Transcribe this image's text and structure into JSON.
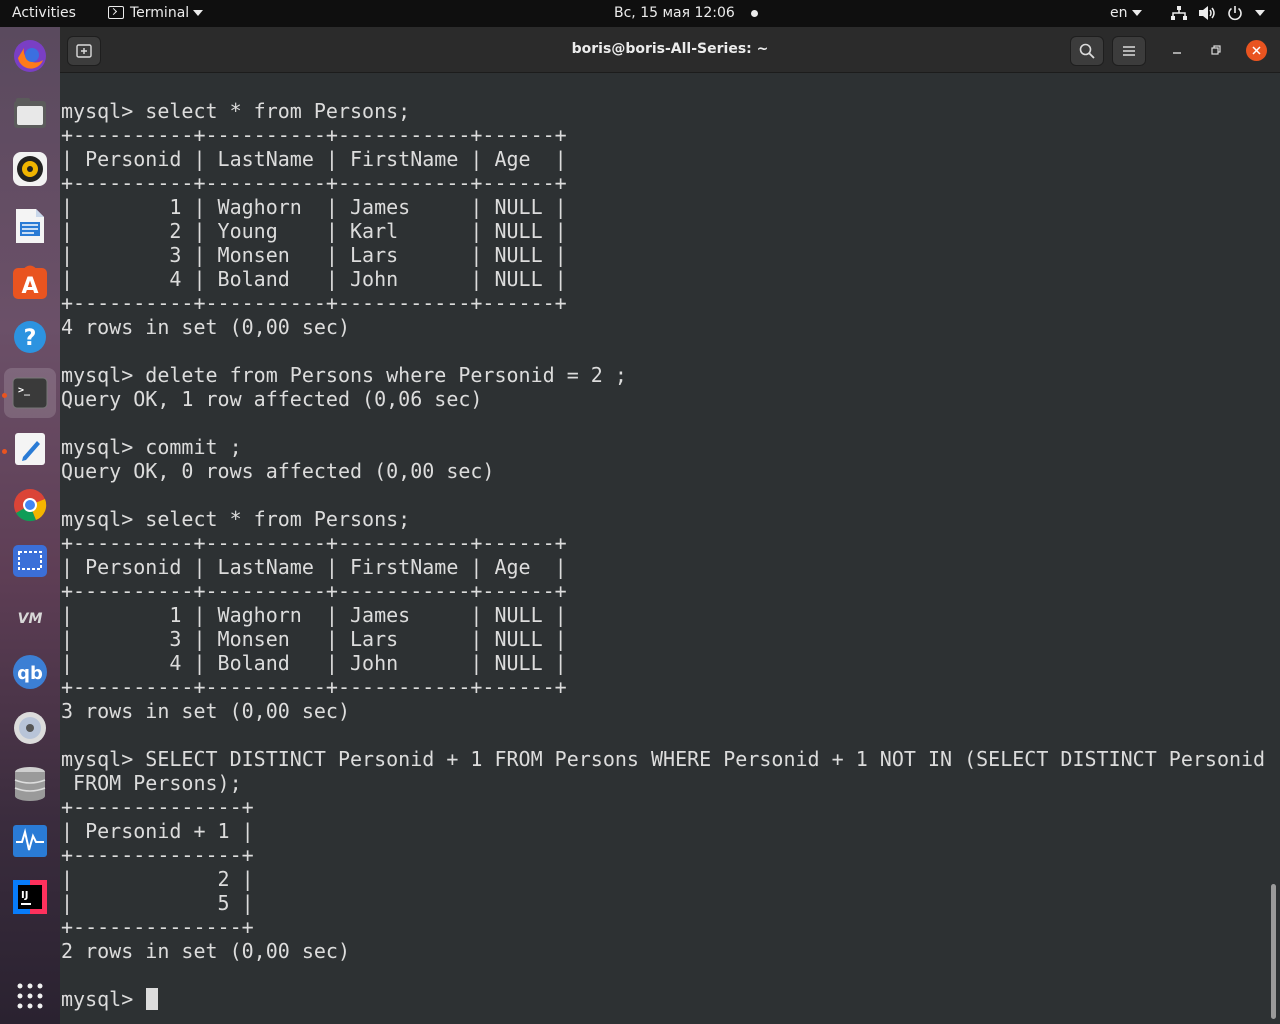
{
  "topbar": {
    "activities": "Activities",
    "app_name": "Terminal",
    "datetime": "Вс, 15 мая  12:06",
    "language": "en"
  },
  "window": {
    "title": "boris@boris-All-Series: ~"
  },
  "dock": {
    "apps": [
      "firefox-icon",
      "files-icon",
      "rhythmbox-icon",
      "libreoffice-writer-icon",
      "ubuntu-software-icon",
      "help-icon",
      "terminal-icon",
      "text-editor-icon",
      "chrome-icon",
      "screenshot-icon",
      "vmware-icon",
      "qbittorrent-icon",
      "disc-icon",
      "database-icon",
      "system-monitor-icon",
      "intellij-icon",
      "show-applications-icon"
    ]
  },
  "terminal": {
    "lines": [
      "mysql> select * from Persons;",
      "+----------+----------+-----------+------+",
      "| Personid | LastName | FirstName | Age  |",
      "+----------+----------+-----------+------+",
      "|        1 | Waghorn  | James     | NULL |",
      "|        2 | Young    | Karl      | NULL |",
      "|        3 | Monsen   | Lars      | NULL |",
      "|        4 | Boland   | John      | NULL |",
      "+----------+----------+-----------+------+",
      "4 rows in set (0,00 sec)",
      "",
      "mysql> delete from Persons where Personid = 2 ;",
      "Query OK, 1 row affected (0,06 sec)",
      "",
      "mysql> commit ;",
      "Query OK, 0 rows affected (0,00 sec)",
      "",
      "mysql> select * from Persons;",
      "+----------+----------+-----------+------+",
      "| Personid | LastName | FirstName | Age  |",
      "+----------+----------+-----------+------+",
      "|        1 | Waghorn  | James     | NULL |",
      "|        3 | Monsen   | Lars      | NULL |",
      "|        4 | Boland   | John      | NULL |",
      "+----------+----------+-----------+------+",
      "3 rows in set (0,00 sec)",
      "",
      "mysql> SELECT DISTINCT Personid + 1 FROM Persons WHERE Personid + 1 NOT IN (SELECT DISTINCT Personid",
      " FROM Persons);",
      "+--------------+",
      "| Personid + 1 |",
      "+--------------+",
      "|            2 |",
      "|            5 |",
      "+--------------+",
      "2 rows in set (0,00 sec)",
      ""
    ],
    "prompt": "mysql> "
  }
}
